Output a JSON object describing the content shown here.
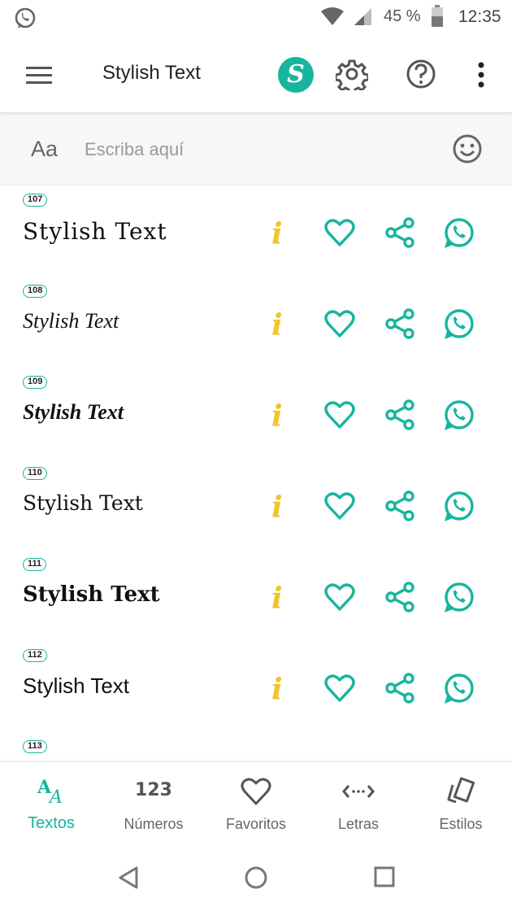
{
  "status_bar": {
    "battery_percent": "45 %",
    "time": "12:35"
  },
  "app_bar": {
    "title": "Stylish Text",
    "logo_glyph": "S"
  },
  "input": {
    "prefix": "Aa",
    "placeholder": "Escriba aquí",
    "value": ""
  },
  "list": {
    "items": [
      {
        "number": "107",
        "text": "Stylish Text"
      },
      {
        "number": "108",
        "text": "Stylish Text"
      },
      {
        "number": "109",
        "text": "Stylish Text"
      },
      {
        "number": "110",
        "text": "Stylish Text"
      },
      {
        "number": "111",
        "text": "Stylish Text"
      },
      {
        "number": "112",
        "text": "Stylish Text"
      },
      {
        "number": "113",
        "text": ""
      }
    ],
    "info_glyph": "i"
  },
  "bottom_nav": {
    "items": [
      {
        "label": "Textos",
        "icon": "aa-text-icon",
        "active": true
      },
      {
        "label": "Números",
        "icon": "123-icon",
        "glyph": "123",
        "active": false
      },
      {
        "label": "Favoritos",
        "icon": "heart-icon",
        "active": false
      },
      {
        "label": "Letras",
        "icon": "arrows-letters-icon",
        "active": false
      },
      {
        "label": "Estilos",
        "icon": "styles-cards-icon",
        "active": false
      }
    ]
  },
  "colors": {
    "accent": "#17b59f",
    "info": "#f2c428"
  }
}
